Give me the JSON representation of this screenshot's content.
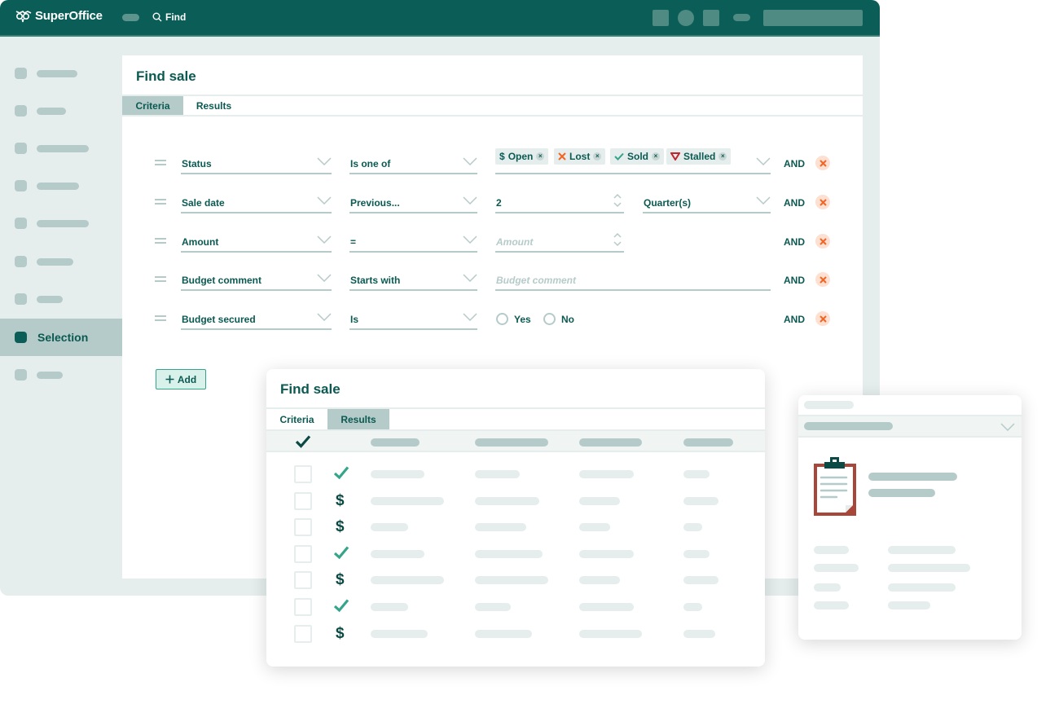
{
  "app": {
    "brand": "SuperOffice",
    "find_label": "Find",
    "colors": {
      "primary": "#0b5e57",
      "accent": "#34a58a",
      "danger": "#f26522",
      "muted": "#b5cbc9",
      "light": "#e5eeed",
      "clipboard": "#a8463a"
    }
  },
  "topbar": {
    "icons": [
      "menu-toggle-icon",
      "search-icon",
      "square-icon",
      "circle-icon",
      "square-icon",
      "pill-icon",
      "search-field"
    ]
  },
  "sidebar": {
    "items": [
      {
        "label": "",
        "placeholder": true
      },
      {
        "label": "",
        "placeholder": true
      },
      {
        "label": "",
        "placeholder": true
      },
      {
        "label": "",
        "placeholder": true
      },
      {
        "label": "",
        "placeholder": true
      },
      {
        "label": "",
        "placeholder": true
      },
      {
        "label": "",
        "placeholder": true
      },
      {
        "label": "Selection",
        "active": true
      },
      {
        "label": "",
        "placeholder": true
      }
    ]
  },
  "find_panel": {
    "title": "Find sale",
    "tabs": [
      {
        "label": "Criteria",
        "active": true
      },
      {
        "label": "Results",
        "active": false
      }
    ],
    "criteria": [
      {
        "field": "Status",
        "operator": "Is one of",
        "chips": [
          {
            "label": "Open",
            "icon": "dollar-icon",
            "color": "#0b5e57"
          },
          {
            "label": "Lost",
            "icon": "x-icon",
            "color": "#f26522"
          },
          {
            "label": "Sold",
            "icon": "check-icon",
            "color": "#34a58a"
          },
          {
            "label": "Stalled",
            "icon": "triangle-down-icon",
            "color": "#c0272d"
          }
        ],
        "conjunction": "AND"
      },
      {
        "field": "Sale date",
        "operator": "Previous...",
        "value": "2",
        "unit": "Quarter(s)",
        "conjunction": "AND"
      },
      {
        "field": "Amount",
        "operator": "=",
        "value_placeholder": "Amount",
        "conjunction": "AND"
      },
      {
        "field": "Budget comment",
        "operator": "Starts with",
        "value_placeholder": "Budget comment",
        "conjunction": "AND"
      },
      {
        "field": "Budget secured",
        "operator": "Is",
        "options": [
          "Yes",
          "No"
        ],
        "conjunction": "AND"
      }
    ],
    "add_label": "Add"
  },
  "results_card": {
    "title": "Find sale",
    "tabs": [
      {
        "label": "Criteria",
        "active": false
      },
      {
        "label": "Results",
        "active": true
      }
    ],
    "rows": [
      {
        "status": "sold"
      },
      {
        "status": "open"
      },
      {
        "status": "open"
      },
      {
        "status": "sold"
      },
      {
        "status": "open"
      },
      {
        "status": "sold"
      },
      {
        "status": "open"
      }
    ]
  },
  "detail_card": {
    "icon": "clipboard-icon"
  }
}
